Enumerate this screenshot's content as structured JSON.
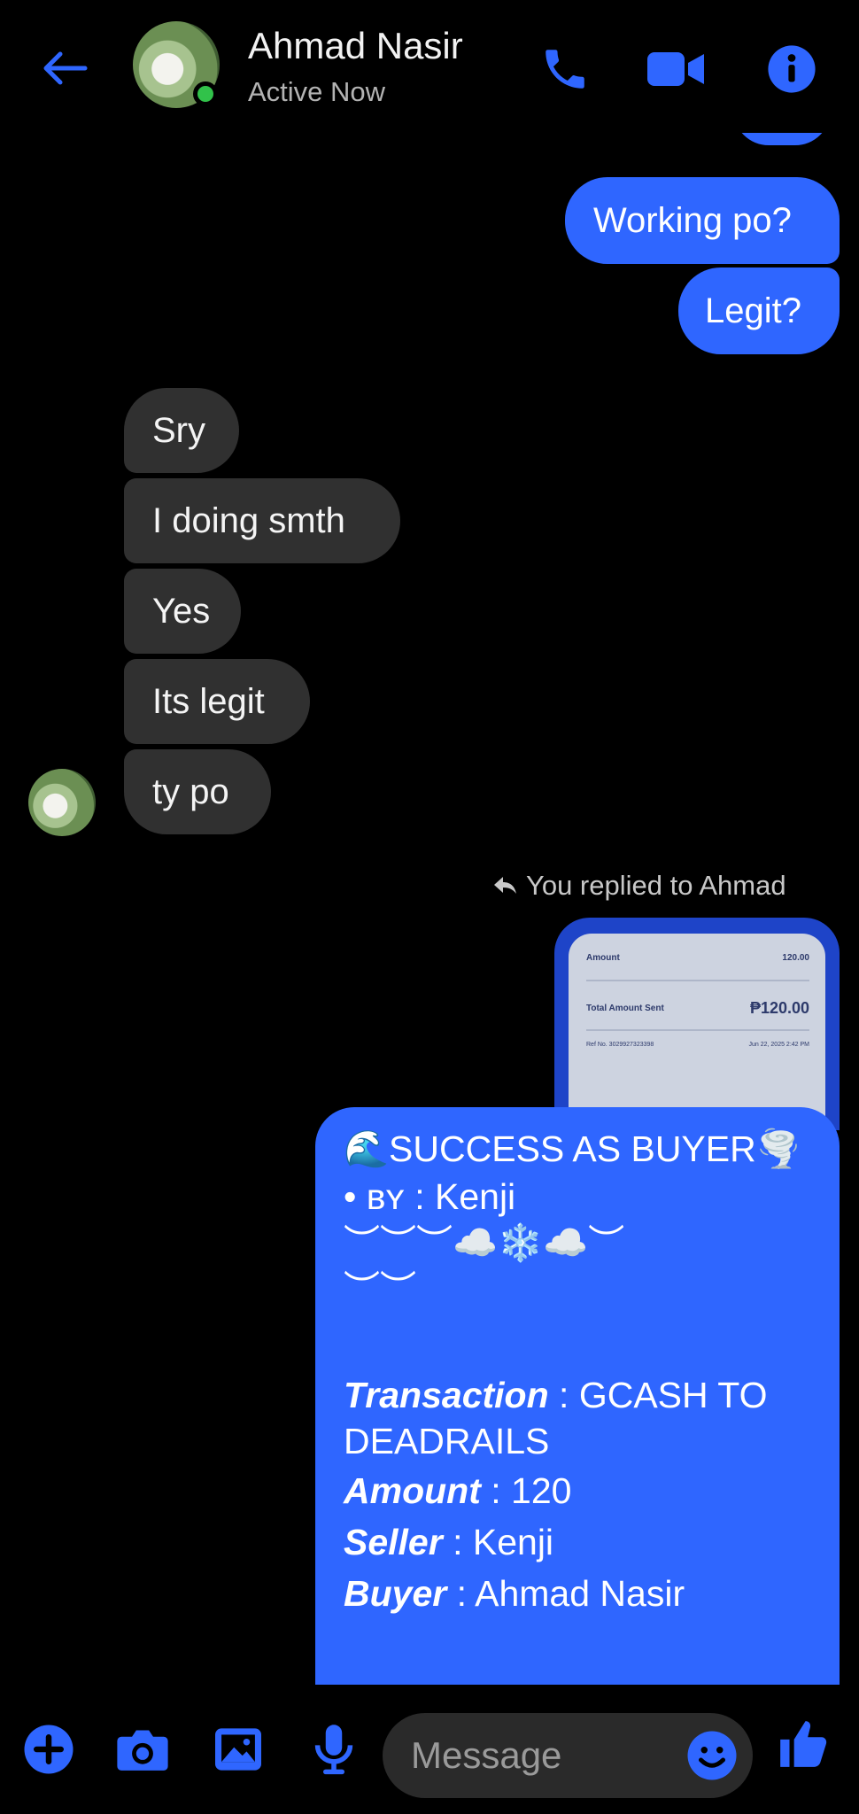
{
  "header": {
    "contact_name": "Ahmad Nasir",
    "status": "Active Now",
    "accent_color": "#2f66ff",
    "online_color": "#31c24a",
    "icons": [
      "back-arrow-icon",
      "phone-icon",
      "video-camera-icon",
      "info-icon"
    ]
  },
  "messages": [
    {
      "direction": "outgoing",
      "text": "Working po?"
    },
    {
      "direction": "outgoing",
      "text": "Legit?"
    },
    {
      "direction": "incoming",
      "text": "Sry"
    },
    {
      "direction": "incoming",
      "text": "I doing smth"
    },
    {
      "direction": "incoming",
      "text": "Yes"
    },
    {
      "direction": "incoming",
      "text": "Its legit"
    },
    {
      "direction": "incoming",
      "text": "ty po"
    }
  ],
  "reply_note": "You replied to Ahmad",
  "receipt_preview": {
    "amount_label": "Amount",
    "amount_value": "120.00",
    "total_label": "Total Amount Sent",
    "total_value": "₱120.00",
    "ref_label": "Ref No. 3029927323398",
    "datetime": "Jun 22, 2025 2:42 PM"
  },
  "success_message": {
    "title": "🌊SUCCESS AS BUYER🌪️",
    "by_line": "• ʙʏ : Kenji",
    "decor_1": "︶︶︶☁️❄️☁️︶",
    "decor_2": "︶︶",
    "transaction_label": "Transaction",
    "transaction_value": " : GCASH TO",
    "transaction_value_2": "DEADRAILS",
    "amount_label": "Amount",
    "amount_value": " : 120",
    "seller_label": "Seller",
    "seller_value": " : Kenji",
    "buyer_label": "Buyer",
    "buyer_value": " : Ahmad Nasir"
  },
  "composer": {
    "placeholder": "Message",
    "icons": [
      "plus-icon",
      "camera-icon",
      "image-icon",
      "microphone-icon",
      "emoji-icon",
      "thumbs-up-icon"
    ]
  }
}
